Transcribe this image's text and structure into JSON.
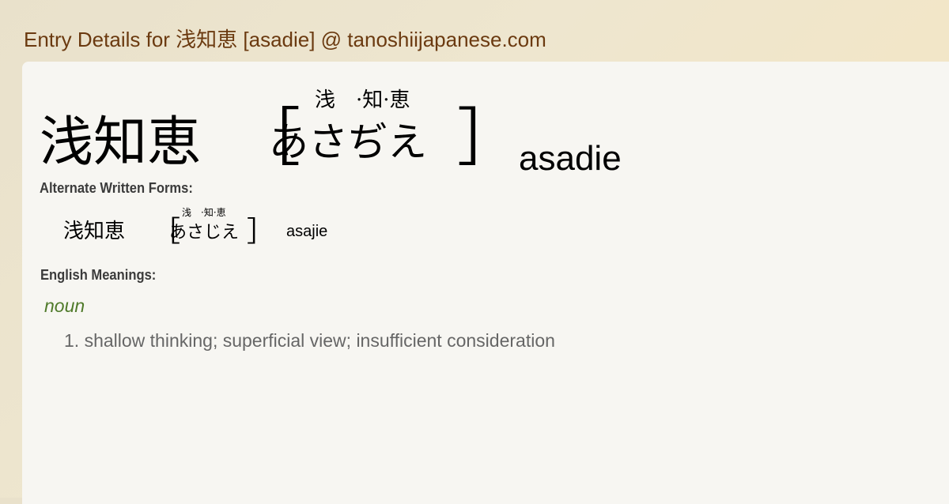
{
  "page": {
    "title": "Entry Details for 浅知恵 [asadie] @ tanoshiijapanese.com"
  },
  "entry": {
    "kanji": "浅知恵",
    "bracket_open": "［",
    "bracket_close": "］",
    "furigana": "浅　·知·恵",
    "kana": "あさぢえ",
    "romaji": "asadie"
  },
  "alternate": {
    "label": "Alternate Written Forms:",
    "items": [
      {
        "kanji": "浅知恵",
        "bracket_open": "［",
        "bracket_close": "］",
        "furigana": "浅　·知·恵",
        "kana": "あさじえ",
        "romaji": "asajie"
      }
    ]
  },
  "meanings": {
    "label": "English Meanings:",
    "part_of_speech": "noun",
    "items": [
      "1. shallow thinking; superficial view; insufficient consideration"
    ]
  }
}
